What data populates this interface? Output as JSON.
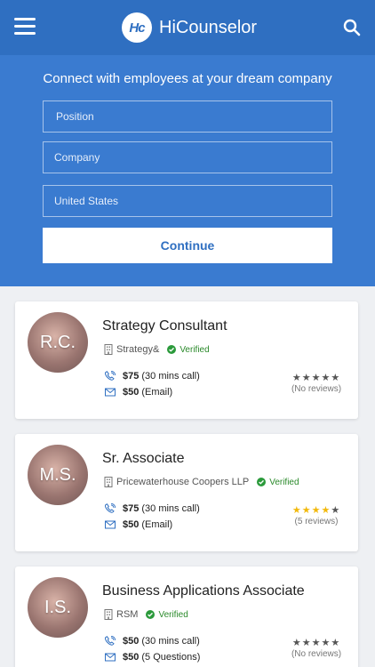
{
  "header": {
    "app_name": "HiCounselor",
    "logo_mark": "Hc"
  },
  "hero": {
    "title": "Connect with employees at your dream company",
    "position_placeholder": "Position",
    "company_placeholder": "Company",
    "country_value": "United States",
    "continue_label": "Continue"
  },
  "cards": [
    {
      "initials": "R.C.",
      "title": "Strategy Consultant",
      "company": "Strategy&",
      "verified": "Verified",
      "price1": "$75",
      "price1_note": "(30 mins call)",
      "price2": "$50",
      "price2_note": "(Email)",
      "rating": 0,
      "reviews": "(No reviews)"
    },
    {
      "initials": "M.S.",
      "title": "Sr. Associate",
      "company": "Pricewaterhouse Coopers LLP",
      "verified": "Verified",
      "price1": "$75",
      "price1_note": "(30 mins call)",
      "price2": "$50",
      "price2_note": "(Email)",
      "rating": 4,
      "reviews": "(5 reviews)"
    },
    {
      "initials": "I.S.",
      "title": "Business Applications Associate",
      "company": "RSM",
      "verified": "Verified",
      "price1": "$50",
      "price1_note": "(30 mins call)",
      "price2": "$50",
      "price2_note": "(5 Questions)",
      "rating": 0,
      "reviews": "(No reviews)"
    }
  ],
  "colors": {
    "brand_blue": "#2f6fc1",
    "hero_blue": "#3a7bd0",
    "verified_green": "#2b8a2b",
    "star_gold": "#f2b90c"
  },
  "icons": [
    "menu-icon",
    "search-icon",
    "building-icon",
    "check-circle-icon",
    "phone-icon",
    "email-icon",
    "star-icon"
  ]
}
